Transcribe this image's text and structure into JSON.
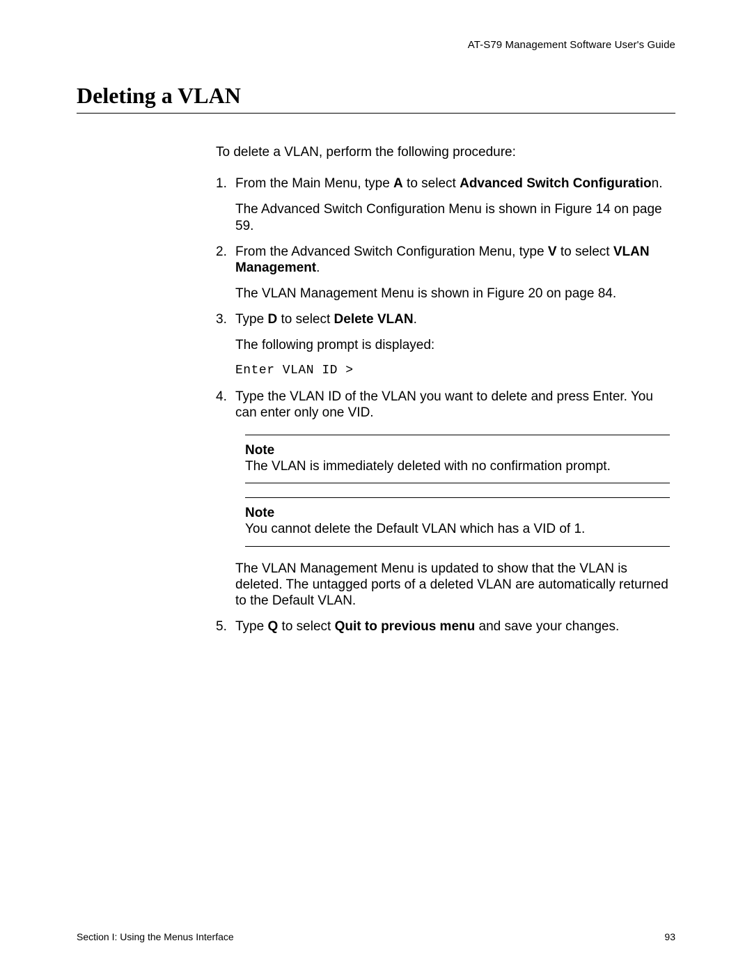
{
  "header": {
    "running_head": "AT-S79 Management Software User's Guide"
  },
  "title": "Deleting a VLAN",
  "intro": "To delete a VLAN, perform the following procedure:",
  "steps": {
    "s1": {
      "pre": "From the Main Menu, type ",
      "key": "A",
      "mid": " to select ",
      "bold": "Advanced Switch Configuratio",
      "tail": "n.",
      "after": "The Advanced Switch Configuration Menu is shown in Figure 14 on page 59."
    },
    "s2": {
      "pre": "From the Advanced Switch Configuration Menu, type ",
      "key": "V",
      "mid": " to select ",
      "bold": "VLAN Management",
      "tail": ".",
      "after": "The VLAN Management Menu is shown in Figure 20 on page 84."
    },
    "s3": {
      "pre": "Type ",
      "key": "D",
      "mid": " to select ",
      "bold": "Delete VLAN",
      "tail": ".",
      "after": "The following prompt is displayed:",
      "code": "Enter VLAN ID >"
    },
    "s4": {
      "text": "Type the VLAN ID of the VLAN you want to delete and press Enter. You can enter only one VID.",
      "note1_label": "Note",
      "note1_body": "The VLAN is immediately deleted with no confirmation prompt.",
      "note2_label": "Note",
      "note2_body": "You cannot delete the Default VLAN which has a VID of 1.",
      "after": "The VLAN Management Menu is updated to show that the VLAN is deleted. The untagged ports of a deleted VLAN are automatically returned to the Default VLAN."
    },
    "s5": {
      "pre": "Type ",
      "key": "Q",
      "mid": " to select ",
      "bold": "Quit to previous menu",
      "tail": " and save your changes."
    }
  },
  "footer": {
    "left": "Section I: Using the Menus Interface",
    "right": "93"
  }
}
